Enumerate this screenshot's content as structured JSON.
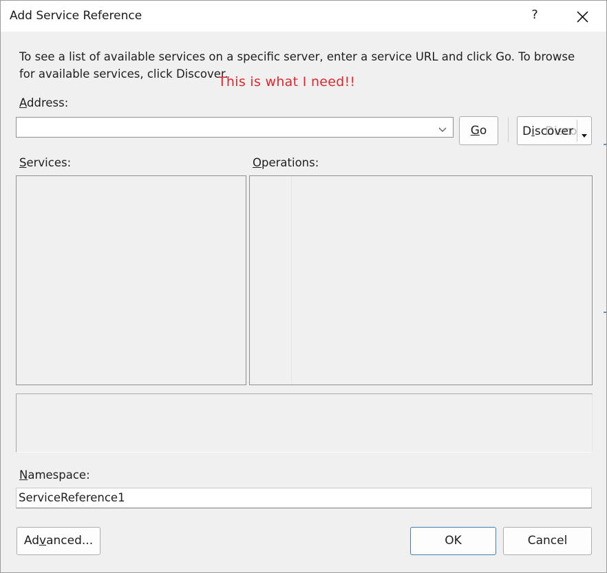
{
  "dialog": {
    "title": "Add Service Reference",
    "help_glyph": "?",
    "description": "To see a list of available services on a specific server, enter a service URL and click Go. To browse for available services, click Discover.",
    "annotation": "This is what I need!!",
    "annotation_color": "#e0262d"
  },
  "address": {
    "label_underlined": "A",
    "label_rest": "ddress:",
    "value": ""
  },
  "buttons": {
    "go_underlined": "G",
    "go_rest": "o",
    "discover_prefix": "D",
    "discover_underlined": "i",
    "discover_rest": "scover",
    "discover_ghost": "Discover",
    "advanced_prefix": "Ad",
    "advanced_underlined": "v",
    "advanced_rest": "anced...",
    "ok": "OK",
    "cancel": "Cancel"
  },
  "services": {
    "label_underlined": "S",
    "label_rest": "ervices:"
  },
  "operations": {
    "label_underlined": "O",
    "label_rest": "perations:"
  },
  "namespace": {
    "label_underlined": "N",
    "label_rest": "amespace:",
    "value": "ServiceReference1"
  },
  "icons": {
    "close": "close-icon",
    "dropdown": "chevron-down-icon",
    "split_arrow": "caret-down-icon"
  },
  "colors": {
    "ok_border": "#3c7fb1",
    "dialog_bg": "#f0f0f0"
  }
}
